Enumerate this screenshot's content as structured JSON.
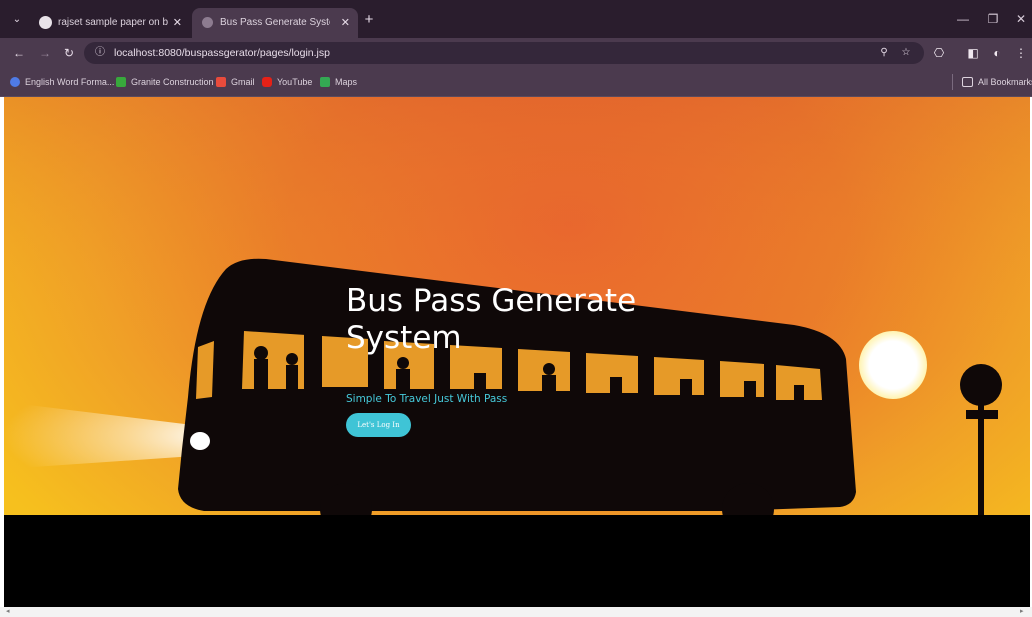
{
  "browser": {
    "tabs": [
      {
        "title": "rajset sample paper on bus pas",
        "active": false
      },
      {
        "title": "Bus Pass Generate System",
        "active": true
      }
    ],
    "new_tab_label": "+",
    "tab_close_glyph": "✕",
    "url": "localhost:8080/buspassgerator/pages/login.jsp",
    "bookmarks": [
      {
        "label": "English Word Forma...",
        "icon": "globe-icon",
        "color": "#4f7be6"
      },
      {
        "label": "Granite Construction",
        "icon": "granite-icon",
        "color": "#38a83c"
      },
      {
        "label": "Gmail",
        "icon": "gmail-icon",
        "color": "#e84b3c"
      },
      {
        "label": "YouTube",
        "icon": "youtube-icon",
        "color": "#e62117"
      },
      {
        "label": "Maps",
        "icon": "maps-icon",
        "color": "#34a853"
      }
    ],
    "all_bookmarks_label": "All Bookmarks"
  },
  "page": {
    "title": "Bus Pass Generate System",
    "subtitle": "Simple To Travel Just With Pass",
    "cta_label": "Let's Log In"
  },
  "colors": {
    "accent": "#3fc4d6",
    "sky_top": "#e9612f",
    "sky_bottom": "#f3c61f",
    "chrome_dark": "#2a1d2d",
    "chrome": "#4b3a4e"
  }
}
